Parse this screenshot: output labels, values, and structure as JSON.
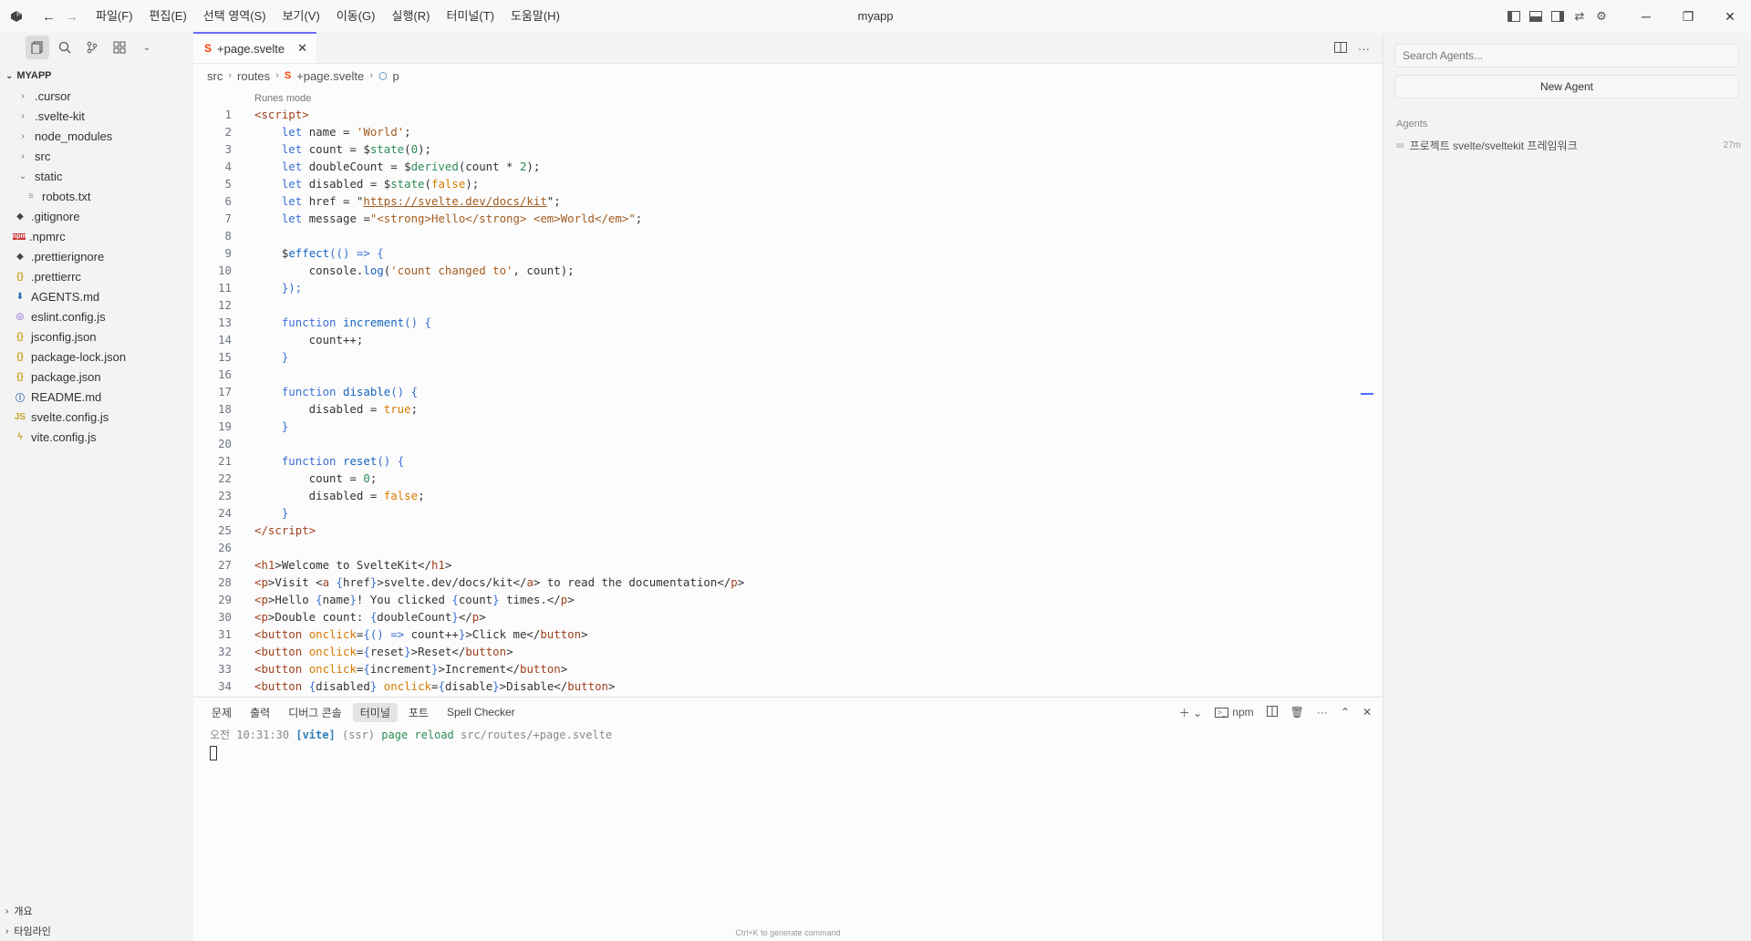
{
  "window": {
    "title": "myapp"
  },
  "menu": [
    "파일(F)",
    "편집(E)",
    "선택 영역(S)",
    "보기(V)",
    "이동(G)",
    "실행(R)",
    "터미널(T)",
    "도움말(H)"
  ],
  "explorer": {
    "root": "MYAPP",
    "items": [
      {
        "name": ".cursor",
        "type": "folder",
        "icon": "›",
        "color": "#666",
        "indent": 18
      },
      {
        "name": ".svelte-kit",
        "type": "folder",
        "icon": "›",
        "color": "#666",
        "indent": 18
      },
      {
        "name": "node_modules",
        "type": "folder",
        "icon": "›",
        "color": "#666",
        "indent": 18
      },
      {
        "name": "src",
        "type": "folder",
        "icon": "›",
        "color": "#666",
        "indent": 18
      },
      {
        "name": "static",
        "type": "folder-open",
        "icon": "⌄",
        "color": "#666",
        "indent": 18
      },
      {
        "name": "robots.txt",
        "type": "file",
        "icon": "≡",
        "color": "#999",
        "indent": 26
      },
      {
        "name": ".gitignore",
        "type": "file",
        "icon": "◆",
        "color": "#444",
        "indent": 14
      },
      {
        "name": ".npmrc",
        "type": "file",
        "icon": "npm",
        "color": "#cc3333",
        "indent": 14
      },
      {
        "name": ".prettierignore",
        "type": "file",
        "icon": "◆",
        "color": "#444",
        "indent": 14
      },
      {
        "name": ".prettierrc",
        "type": "file",
        "icon": "{}",
        "color": "#c9a227",
        "indent": 14
      },
      {
        "name": "AGENTS.md",
        "type": "file",
        "icon": "⬇",
        "color": "#2b6cb0",
        "indent": 14
      },
      {
        "name": "eslint.config.js",
        "type": "file",
        "icon": "◎",
        "color": "#7c4dcc",
        "indent": 14
      },
      {
        "name": "jsconfig.json",
        "type": "file",
        "icon": "{}",
        "color": "#c9a227",
        "indent": 14
      },
      {
        "name": "package-lock.json",
        "type": "file",
        "icon": "{}",
        "color": "#c9a227",
        "indent": 14
      },
      {
        "name": "package.json",
        "type": "file",
        "icon": "{}",
        "color": "#c9a227",
        "indent": 14
      },
      {
        "name": "README.md",
        "type": "file",
        "icon": "ⓘ",
        "color": "#2b6cb0",
        "indent": 14
      },
      {
        "name": "svelte.config.js",
        "type": "file",
        "icon": "JS",
        "color": "#c9a227",
        "indent": 14
      },
      {
        "name": "vite.config.js",
        "type": "file",
        "icon": "ϟ",
        "color": "#c9a227",
        "indent": 14
      }
    ],
    "bottom_sections": [
      "개요",
      "타임라인"
    ]
  },
  "tab": {
    "label": "+page.svelte",
    "icon_color": "#ff3e00"
  },
  "breadcrumb": [
    "src",
    "routes",
    "+page.svelte",
    "p"
  ],
  "codelens": "Runes mode",
  "panel": {
    "tabs": [
      "문제",
      "출력",
      "디버그 콘솔",
      "터미널",
      "포트",
      "Spell Checker"
    ],
    "active_tab": 3,
    "npm_label": "npm",
    "terminal": {
      "time": "오전 10:31:30",
      "tag": "[vite]",
      "ssr": "(ssr)",
      "action": "page reload",
      "path": "src/routes/+page.svelte"
    },
    "hint": "Ctrl+K to generate command"
  },
  "agents": {
    "search_placeholder": "Search Agents...",
    "new_agent": "New Agent",
    "section": "Agents",
    "items": [
      {
        "title": "프로젝트 svelte/sveltekit 프레임워크",
        "age": "27m"
      }
    ]
  },
  "code": [
    [
      [
        "t",
        "<script"
      ],
      [
        "",
        ""
      ],
      [
        "t",
        ">"
      ]
    ],
    [
      [
        "",
        "    "
      ],
      [
        "k",
        "let"
      ],
      [
        "",
        " name = "
      ],
      [
        "s",
        "'World'"
      ],
      [
        "",
        ";"
      ]
    ],
    [
      [
        "",
        "    "
      ],
      [
        "k",
        "let"
      ],
      [
        "",
        " count = $"
      ],
      [
        "n",
        "state"
      ],
      [
        "",
        "("
      ],
      [
        "n",
        "0"
      ],
      [
        "",
        ");"
      ]
    ],
    [
      [
        "",
        "    "
      ],
      [
        "k",
        "let"
      ],
      [
        "",
        " doubleCount = $"
      ],
      [
        "n",
        "derived"
      ],
      [
        "",
        "(count * "
      ],
      [
        "n",
        "2"
      ],
      [
        "",
        ");"
      ]
    ],
    [
      [
        "",
        "    "
      ],
      [
        "k",
        "let"
      ],
      [
        "",
        " disabled = $"
      ],
      [
        "n",
        "state"
      ],
      [
        "",
        "("
      ],
      [
        "a",
        "false"
      ],
      [
        "",
        ");"
      ]
    ],
    [
      [
        "",
        "    "
      ],
      [
        "k",
        "let"
      ],
      [
        "",
        " href = \""
      ],
      [
        "u",
        "https://svelte.dev/docs/kit"
      ],
      [
        "",
        "\";"
      ]
    ],
    [
      [
        "",
        "    "
      ],
      [
        "k",
        "let"
      ],
      [
        "",
        " message ="
      ],
      [
        "s",
        "\"<strong>Hello</strong> <em>World</em>\""
      ],
      [
        "",
        ";"
      ]
    ],
    [
      [
        "",
        ""
      ]
    ],
    [
      [
        "",
        "    $"
      ],
      [
        "f",
        "effect"
      ],
      [
        "k",
        "(() => {"
      ]
    ],
    [
      [
        "",
        "        console."
      ],
      [
        "f",
        "log"
      ],
      [
        "",
        "("
      ],
      [
        "s",
        "'count changed to'"
      ],
      [
        "",
        ", count);"
      ]
    ],
    [
      [
        "",
        "    "
      ],
      [
        "k",
        "});"
      ]
    ],
    [
      [
        "",
        ""
      ]
    ],
    [
      [
        "",
        "    "
      ],
      [
        "k",
        "function"
      ],
      [
        "",
        " "
      ],
      [
        "f",
        "increment"
      ],
      [
        "k",
        "() {"
      ]
    ],
    [
      [
        "",
        "        count++;"
      ]
    ],
    [
      [
        "",
        "    "
      ],
      [
        "k",
        "}"
      ]
    ],
    [
      [
        "",
        ""
      ]
    ],
    [
      [
        "",
        "    "
      ],
      [
        "k",
        "function"
      ],
      [
        "",
        " "
      ],
      [
        "f",
        "disable"
      ],
      [
        "k",
        "() {"
      ]
    ],
    [
      [
        "",
        "        disabled = "
      ],
      [
        "a",
        "true"
      ],
      [
        "",
        ";"
      ]
    ],
    [
      [
        "",
        "    "
      ],
      [
        "k",
        "}"
      ]
    ],
    [
      [
        "",
        ""
      ]
    ],
    [
      [
        "",
        "    "
      ],
      [
        "k",
        "function"
      ],
      [
        "",
        " "
      ],
      [
        "f",
        "reset"
      ],
      [
        "k",
        "() {"
      ]
    ],
    [
      [
        "",
        "        count = "
      ],
      [
        "n",
        "0"
      ],
      [
        "",
        ";"
      ]
    ],
    [
      [
        "",
        "        disabled = "
      ],
      [
        "a",
        "false"
      ],
      [
        "",
        ";"
      ]
    ],
    [
      [
        "",
        "    "
      ],
      [
        "k",
        "}"
      ]
    ],
    [
      [
        "t",
        "</script"
      ],
      [
        "t",
        ">"
      ]
    ],
    [
      [
        "",
        ""
      ]
    ],
    [
      [
        "t",
        "<h1"
      ],
      [
        "",
        ">Welcome to SvelteKit</"
      ],
      [
        "t",
        "h1"
      ],
      [
        "",
        ">"
      ]
    ],
    [
      [
        "t",
        "<p"
      ],
      [
        "",
        ">Visit <"
      ],
      [
        "t",
        "a"
      ],
      [
        "",
        " "
      ],
      [
        "k",
        "{"
      ],
      [
        "",
        "href"
      ],
      [
        "k",
        "}"
      ],
      [
        "",
        ">svelte.dev/docs/kit</"
      ],
      [
        "t",
        "a"
      ],
      [
        "",
        "> to read the documentation</"
      ],
      [
        "t",
        "p"
      ],
      [
        "",
        ">"
      ]
    ],
    [
      [
        "t",
        "<p"
      ],
      [
        "",
        ">Hello "
      ],
      [
        "k",
        "{"
      ],
      [
        "",
        "name"
      ],
      [
        "k",
        "}"
      ],
      [
        "",
        "! You clicked "
      ],
      [
        "k",
        "{"
      ],
      [
        "",
        "count"
      ],
      [
        "k",
        "}"
      ],
      [
        "",
        " times.</"
      ],
      [
        "t",
        "p"
      ],
      [
        "",
        ">"
      ]
    ],
    [
      [
        "t",
        "<p"
      ],
      [
        "",
        ">Double count: "
      ],
      [
        "k",
        "{"
      ],
      [
        "",
        "doubleCount"
      ],
      [
        "k",
        "}"
      ],
      [
        "",
        "</"
      ],
      [
        "t",
        "p"
      ],
      [
        "",
        ">"
      ]
    ],
    [
      [
        "t",
        "<button"
      ],
      [
        "",
        " "
      ],
      [
        "a",
        "onclick"
      ],
      [
        "",
        "="
      ],
      [
        "k",
        "{() => "
      ],
      [
        "",
        "count++"
      ],
      [
        "k",
        "}"
      ],
      [
        "",
        ">Click me</"
      ],
      [
        "t",
        "button"
      ],
      [
        "",
        ">"
      ]
    ],
    [
      [
        "t",
        "<button"
      ],
      [
        "",
        " "
      ],
      [
        "a",
        "onclick"
      ],
      [
        "",
        "="
      ],
      [
        "k",
        "{"
      ],
      [
        "",
        "reset"
      ],
      [
        "k",
        "}"
      ],
      [
        "",
        ">Reset</"
      ],
      [
        "t",
        "button"
      ],
      [
        "",
        ">"
      ]
    ],
    [
      [
        "t",
        "<button"
      ],
      [
        "",
        " "
      ],
      [
        "a",
        "onclick"
      ],
      [
        "",
        "="
      ],
      [
        "k",
        "{"
      ],
      [
        "",
        "increment"
      ],
      [
        "k",
        "}"
      ],
      [
        "",
        ">Increment</"
      ],
      [
        "t",
        "button"
      ],
      [
        "",
        ">"
      ]
    ],
    [
      [
        "t",
        "<button"
      ],
      [
        "",
        " "
      ],
      [
        "k",
        "{"
      ],
      [
        "",
        "disabled"
      ],
      [
        "k",
        "}"
      ],
      [
        "",
        " "
      ],
      [
        "a",
        "onclick"
      ],
      [
        "",
        "="
      ],
      [
        "k",
        "{"
      ],
      [
        "",
        "disable"
      ],
      [
        "k",
        "}"
      ],
      [
        "",
        ">Disable</"
      ],
      [
        "t",
        "button"
      ],
      [
        "",
        ">"
      ]
    ]
  ]
}
